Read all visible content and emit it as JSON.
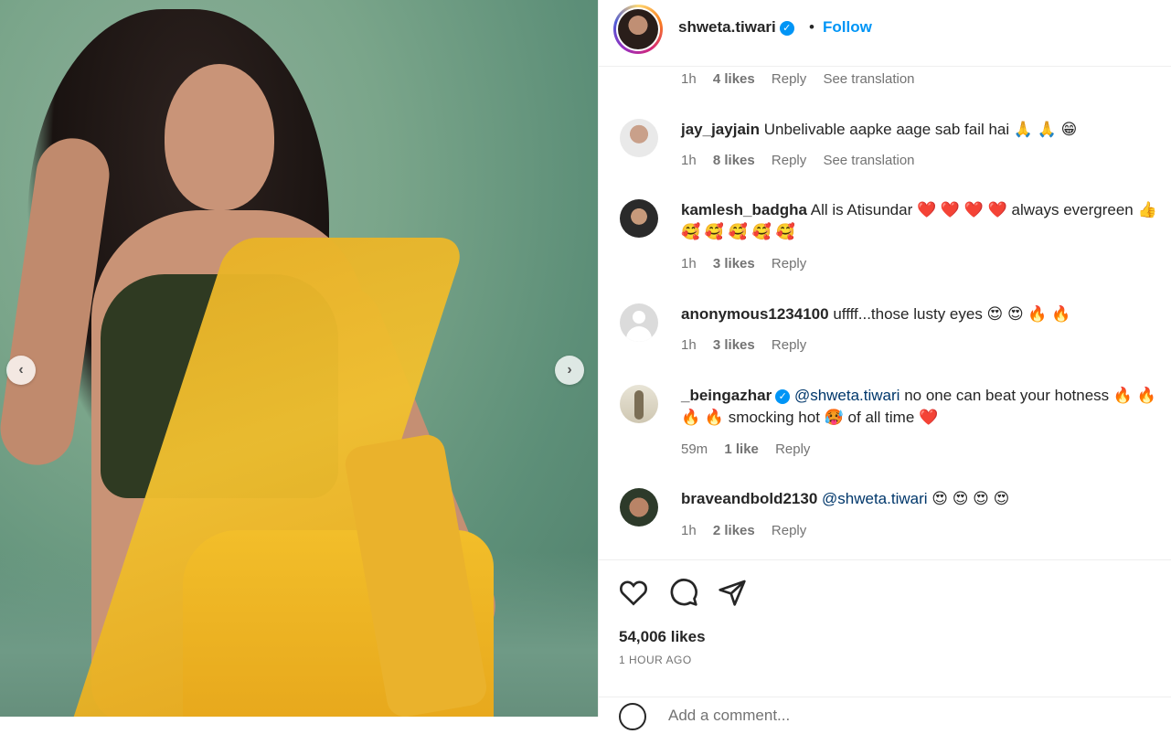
{
  "post": {
    "username": "shweta.tiwari",
    "follow_label": "Follow",
    "dot": "•",
    "likes": "54,006 likes",
    "time": "1 HOUR AGO",
    "add_comment_placeholder": "Add a comment..."
  },
  "nav": {
    "prev": "‹",
    "next": "›"
  },
  "meta_reply": "Reply",
  "meta_see_translation": "See translation",
  "top_meta": {
    "time": "1h",
    "likes": "4 likes"
  },
  "comments": [
    {
      "username": "jay_jayjain",
      "text": "Unbelivable aapke aage sab fail hai 🙏 🙏 😁",
      "time": "1h",
      "likes": "8 likes",
      "translation": true
    },
    {
      "username": "kamlesh_badgha",
      "text": "All is Atisundar ❤️ ❤️ ❤️ ❤️ always evergreen 👍 🥰 🥰 🥰 🥰 🥰",
      "time": "1h",
      "likes": "3 likes"
    },
    {
      "username": "anonymous1234100",
      "text": "uffff...those lusty eyes 😍 😍 🔥 🔥",
      "time": "1h",
      "likes": "3 likes"
    },
    {
      "username": "_beingazhar",
      "mention": "@shweta.tiwari",
      "text": "no one can beat your hotness 🔥 🔥 🔥 🔥 smocking hot 🥵 of all time ❤️",
      "time": "59m",
      "likes": "1 like",
      "verified": true
    },
    {
      "username": "braveandbold2130",
      "mention": "@shweta.tiwari",
      "text": "😍 😍 😍 😍",
      "time": "1h",
      "likes": "2 likes"
    }
  ],
  "colors": {
    "accent": "#0095f6",
    "text": "#262626",
    "muted": "#737373"
  },
  "icons": [
    "heart-icon",
    "comment-icon",
    "share-icon",
    "emoji-icon",
    "verified-icon",
    "chevron-left-icon",
    "chevron-right-icon"
  ]
}
